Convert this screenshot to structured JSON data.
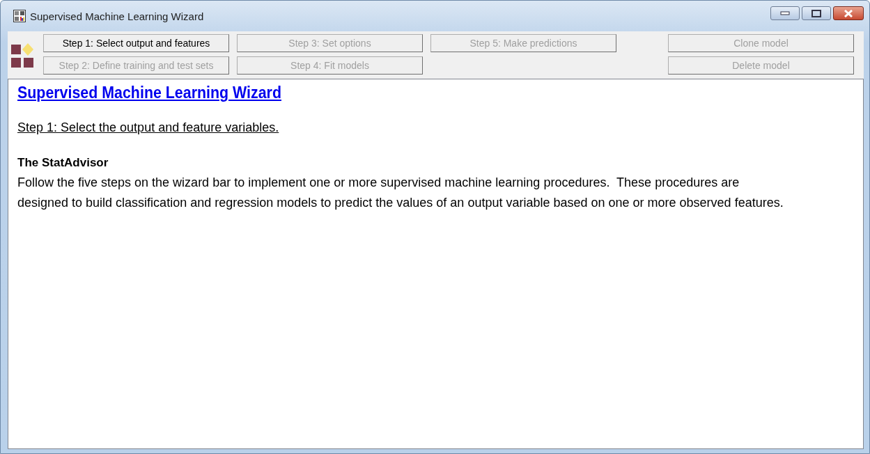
{
  "window": {
    "title": "Supervised Machine Learning Wizard"
  },
  "toolbar": {
    "buttons": [
      {
        "label": "Step 1: Select output and features",
        "kind": "step",
        "disabled": false
      },
      {
        "label": "Step 3: Set options",
        "kind": "step",
        "disabled": true
      },
      {
        "label": "Step 5: Make predictions",
        "kind": "step",
        "disabled": true
      },
      {
        "label": "Clone model",
        "kind": "model",
        "disabled": true
      },
      {
        "label": "Step 2: Define training and test sets",
        "kind": "step",
        "disabled": true
      },
      {
        "label": "Step 4: Fit models",
        "kind": "step",
        "disabled": true
      },
      {
        "label": "Delete model",
        "kind": "model",
        "disabled": true
      }
    ]
  },
  "content": {
    "title": "Supervised Machine Learning Wizard",
    "step": "Step 1: Select the output and feature variables.",
    "advisor_title": "The StatAdvisor",
    "advisor_text": "Follow the five steps on the wizard bar to implement one or more supervised machine learning procedures.  These procedures are designed to build classification and regression models to predict the values of an output variable based on one or more observed features."
  }
}
